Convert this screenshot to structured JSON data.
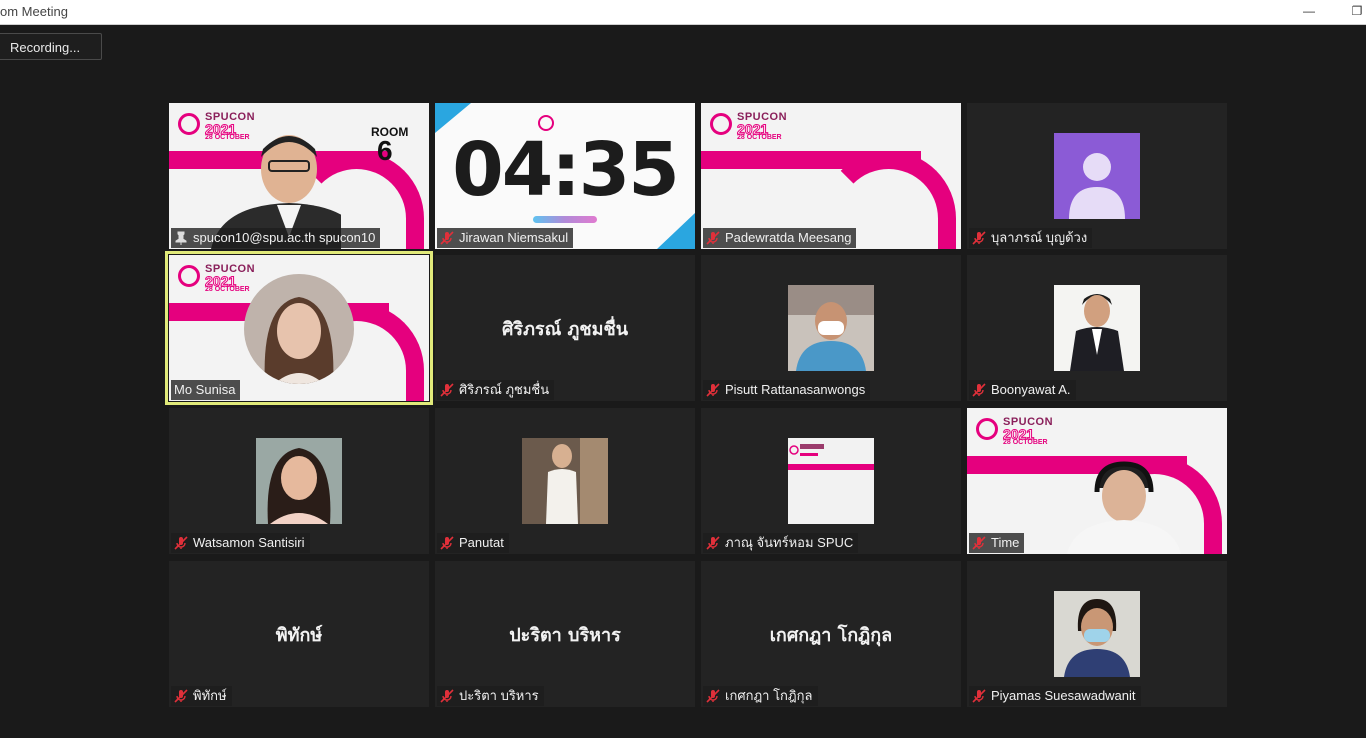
{
  "window": {
    "title": "om Meeting",
    "minimize_glyph": "—",
    "restore_glyph": "❐"
  },
  "recording": {
    "label": "Recording..."
  },
  "slide": {
    "brand": "SPUCON",
    "year": "2021",
    "date": "28 OCTOBER",
    "room_label": "ROOM",
    "room_number": "6"
  },
  "timer": {
    "value": "04:35"
  },
  "participants": [
    {
      "name": "spucon10@spu.ac.th spucon10",
      "icon": "pin-icon",
      "display": "slide-video"
    },
    {
      "name": "Jirawan Niemsakul",
      "icon": "mic-muted-icon",
      "display": "timer"
    },
    {
      "name": "Padewratda Meesang",
      "icon": "mic-muted-icon",
      "display": "slide"
    },
    {
      "name": "บุลาภรณ์ บุญด้วง",
      "icon": "mic-muted-icon",
      "display": "avatar"
    },
    {
      "name": "Mo Sunisa",
      "icon": "",
      "display": "slide-video"
    },
    {
      "name": "ศิริภรณ์ ภูชมชื่น",
      "icon": "mic-muted-icon",
      "display": "name",
      "big_name": "ศิริภรณ์ ภูชมชื่น"
    },
    {
      "name": "Pisutt Rattanasanwongs",
      "icon": "mic-muted-icon",
      "display": "photo"
    },
    {
      "name": "Boonyawat A.",
      "icon": "mic-muted-icon",
      "display": "photo"
    },
    {
      "name": "Watsamon Santisiri",
      "icon": "mic-muted-icon",
      "display": "photo"
    },
    {
      "name": "Panutat",
      "icon": "mic-muted-icon",
      "display": "photo"
    },
    {
      "name": "ภาณุ จันทร์หอม SPUC",
      "icon": "mic-muted-icon",
      "display": "photo-slide"
    },
    {
      "name": "Time",
      "icon": "mic-muted-icon",
      "display": "slide-video"
    },
    {
      "name": "พิทักษ์",
      "icon": "mic-muted-icon",
      "display": "name",
      "big_name": "พิทักษ์"
    },
    {
      "name": "ปะริตา บริหาร",
      "icon": "mic-muted-icon",
      "display": "name",
      "big_name": "ปะริตา บริหาร"
    },
    {
      "name": "เกศกฎา โกฎิกุล",
      "icon": "mic-muted-icon",
      "display": "name",
      "big_name": "เกศกฎา โกฎิกุล"
    },
    {
      "name": "Piyamas Suesawadwanit",
      "icon": "mic-muted-icon",
      "display": "photo"
    }
  ],
  "colors": {
    "accent": "#e5007e",
    "muted_icon": "#e0303a",
    "active_speaker": "#e1ea7a",
    "avatar_bg": "#8b5bd6"
  }
}
